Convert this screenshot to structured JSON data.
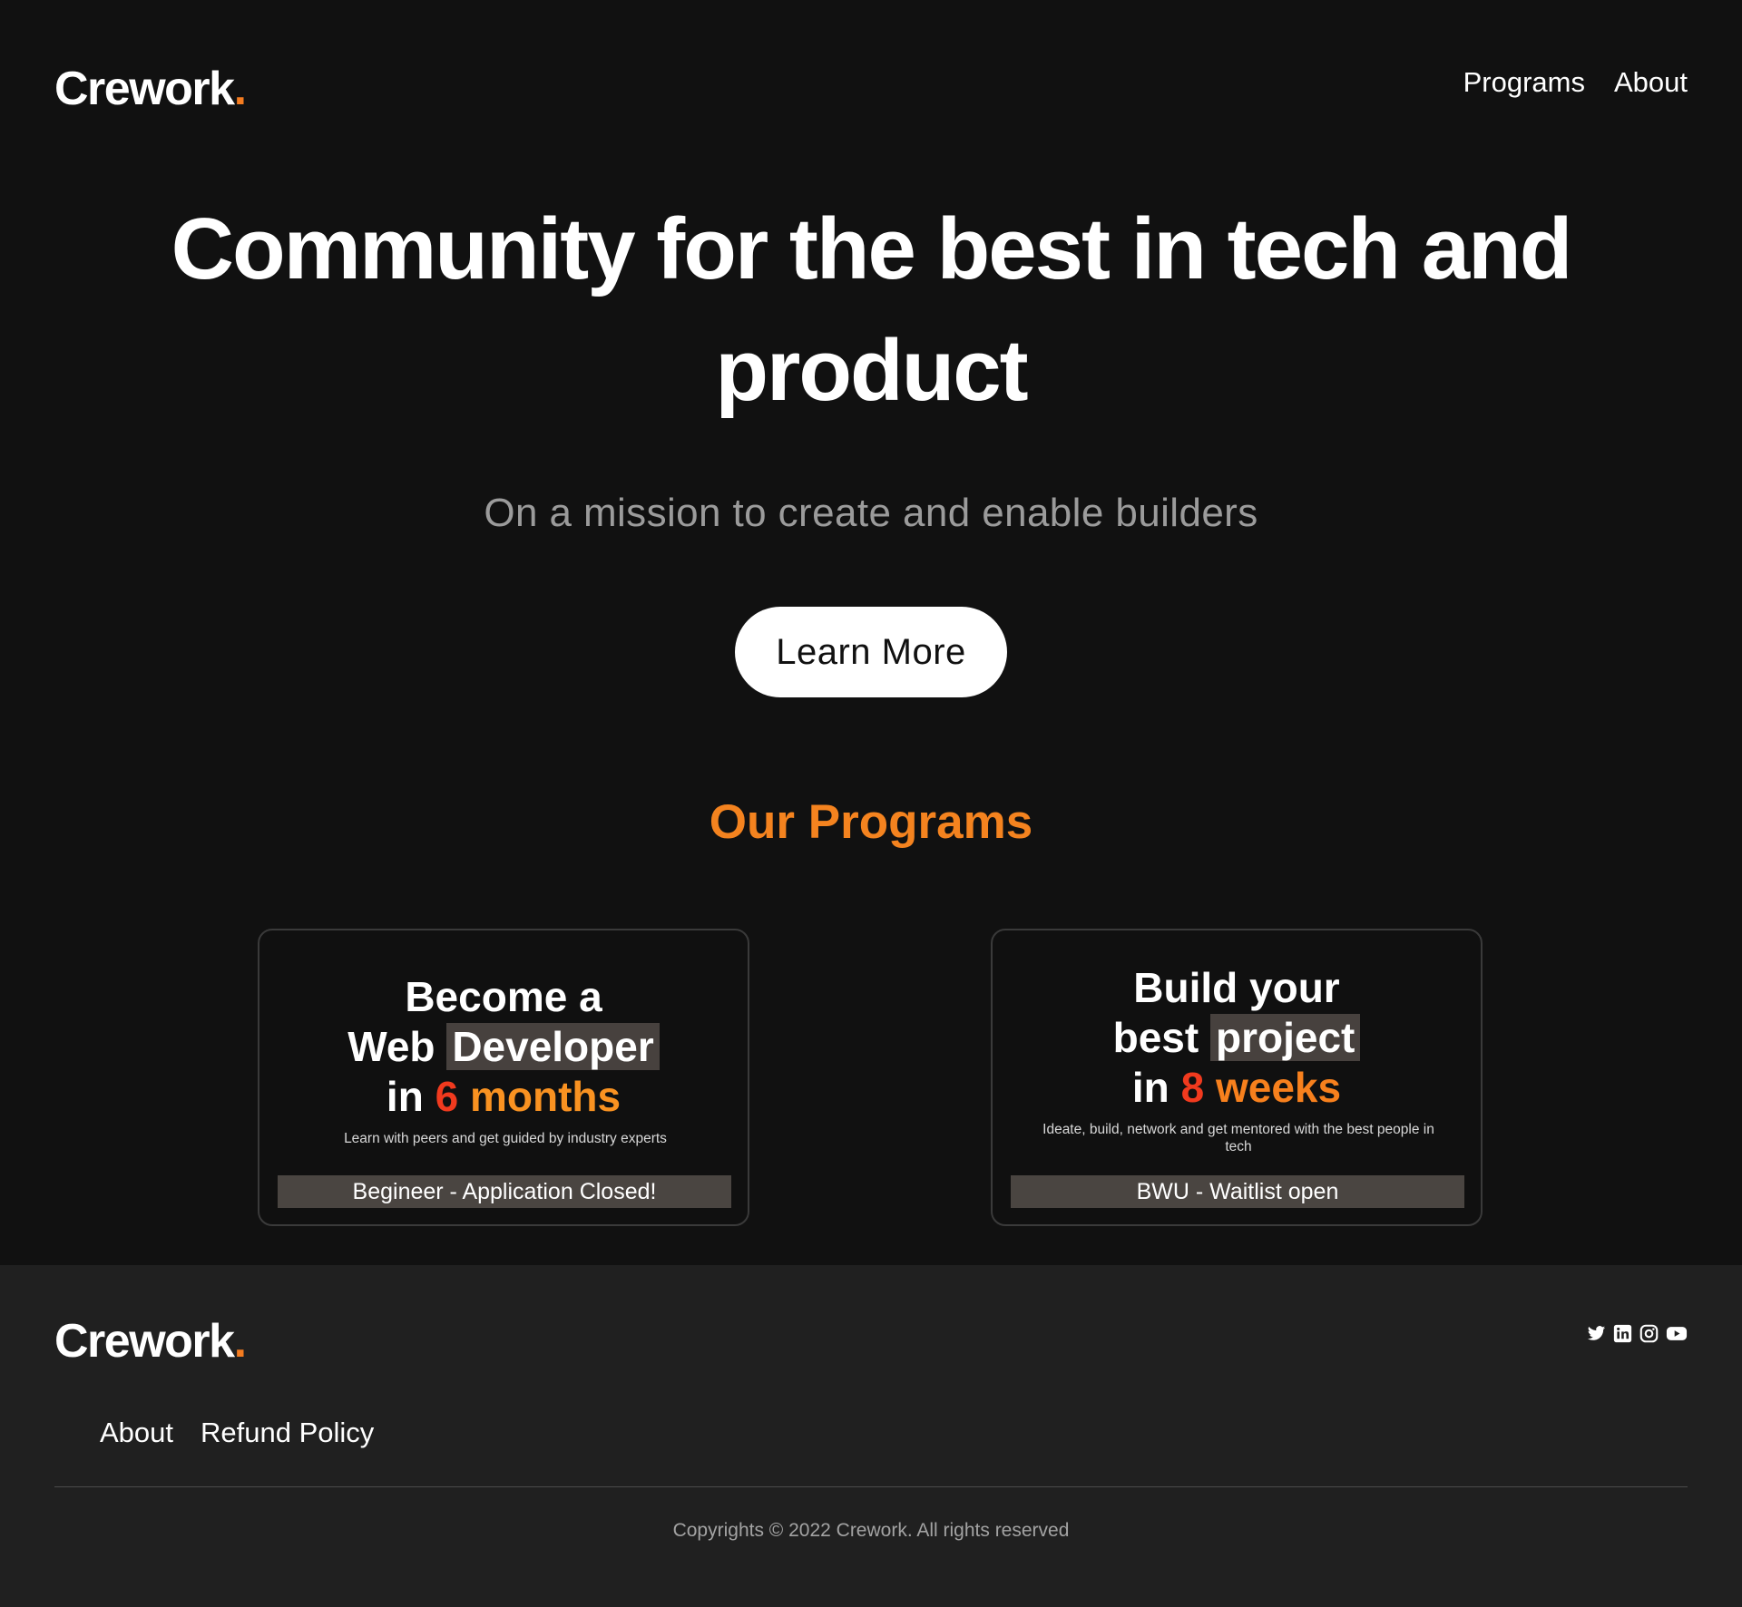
{
  "brand": {
    "name": "Crework",
    "dot": ".",
    "accent_color": "#f47c20"
  },
  "nav": {
    "items": [
      {
        "label": "Programs"
      },
      {
        "label": "About"
      }
    ]
  },
  "hero": {
    "title_line1": "Community for the best in tech and",
    "title_line2": "product",
    "subtitle": "On a mission to create and enable builders",
    "cta_label": "Learn More"
  },
  "programs": {
    "section_title": "Our Programs",
    "cards": [
      {
        "line1": "Become a",
        "line2_plain": "Web",
        "line2_highlight": "Developer",
        "line3_prefix": "in",
        "line3_number": "6",
        "line3_word": "months",
        "description": "Learn with peers and get guided by industry experts",
        "status": "Begineer - Application Closed!"
      },
      {
        "line1": "Build your",
        "line2_plain": "best",
        "line2_highlight": "project",
        "line3_prefix": "in",
        "line3_number": "8",
        "line3_word": "weeks",
        "description": "Ideate, build, network and get mentored with the best people in tech",
        "status": "BWU - Waitlist open"
      }
    ]
  },
  "footer": {
    "social_icons": [
      "twitter-icon",
      "linkedin-icon",
      "instagram-icon",
      "youtube-icon"
    ],
    "links": [
      {
        "label": "About"
      },
      {
        "label": "Refund Policy"
      }
    ],
    "copyright": "Copyrights © 2022 Crework. All rights reserved"
  },
  "colors": {
    "background": "#111111",
    "footer_background": "#202020",
    "section_title": "#f4831f",
    "number_red": "#f13a1e",
    "highlight_box": "#47413e",
    "status_bar": "#4a4541"
  }
}
